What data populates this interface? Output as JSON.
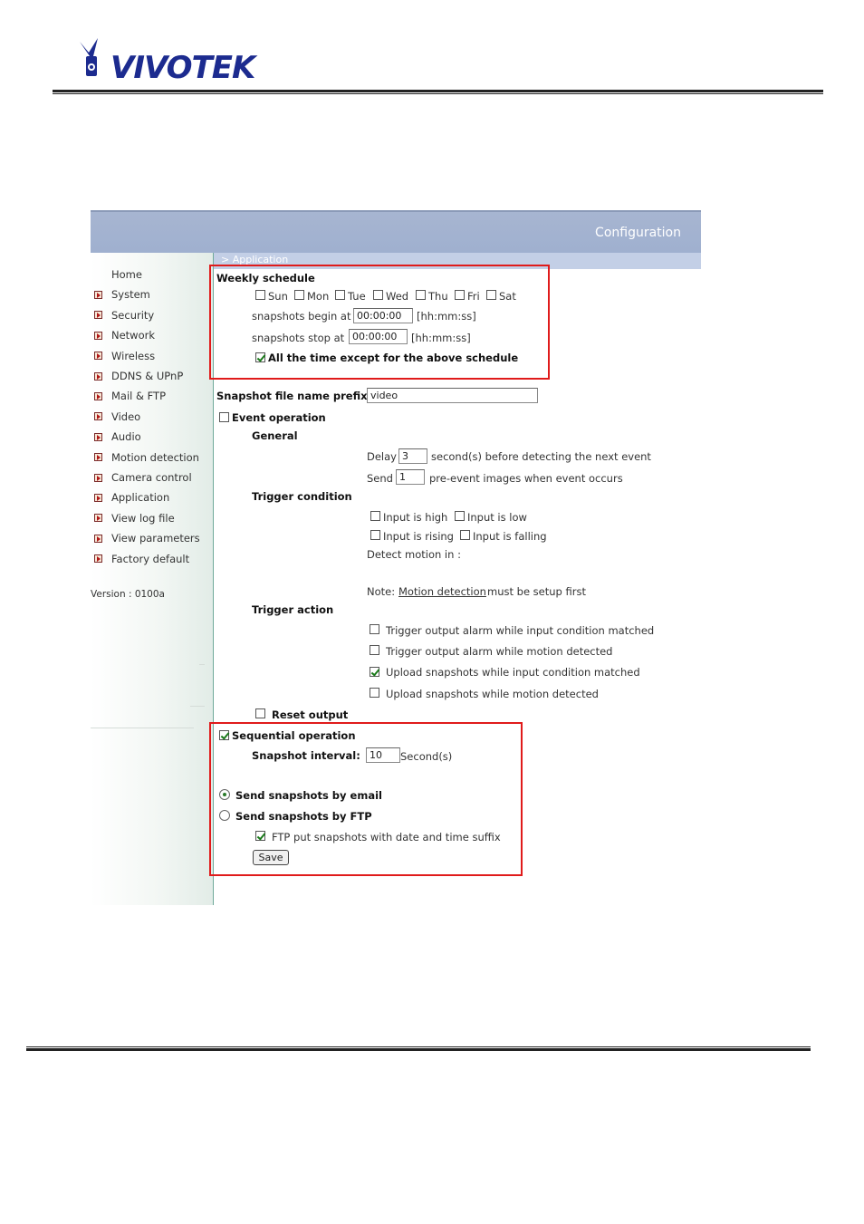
{
  "logo": {
    "text": "VIVOTEK",
    "icon": "vivotek-bird-icon"
  },
  "header": {
    "title": "Configuration",
    "breadcrumb": "> Application"
  },
  "sidebar": {
    "items": [
      {
        "label": "Home",
        "arrow": false
      },
      {
        "label": "System",
        "arrow": true
      },
      {
        "label": "Security",
        "arrow": true
      },
      {
        "label": "Network",
        "arrow": true
      },
      {
        "label": "Wireless",
        "arrow": true
      },
      {
        "label": "DDNS & UPnP",
        "arrow": true
      },
      {
        "label": "Mail & FTP",
        "arrow": true
      },
      {
        "label": "Video",
        "arrow": true
      },
      {
        "label": "Audio",
        "arrow": true
      },
      {
        "label": "Motion detection",
        "arrow": true
      },
      {
        "label": "Camera control",
        "arrow": true
      },
      {
        "label": "Application",
        "arrow": true
      },
      {
        "label": "View log file",
        "arrow": true
      },
      {
        "label": "View parameters",
        "arrow": true
      },
      {
        "label": "Factory default",
        "arrow": true
      }
    ],
    "version": "Version : 0100a"
  },
  "schedule": {
    "title": "Weekly schedule",
    "days": [
      {
        "label": "Sun",
        "checked": false
      },
      {
        "label": "Mon",
        "checked": false
      },
      {
        "label": "Tue",
        "checked": false
      },
      {
        "label": "Wed",
        "checked": false
      },
      {
        "label": "Thu",
        "checked": false
      },
      {
        "label": "Fri",
        "checked": false
      },
      {
        "label": "Sat",
        "checked": false
      }
    ],
    "begin_label": "snapshots begin at",
    "begin_value": "00:00:00",
    "begin_format": "[hh:mm:ss]",
    "stop_label": "snapshots stop at",
    "stop_value": "00:00:00",
    "stop_format": "[hh:mm:ss]",
    "all_time_label": "All the time except for the above schedule",
    "all_time_checked": true
  },
  "prefix": {
    "label": "Snapshot file name prefix",
    "value": "video"
  },
  "event": {
    "label": "Event operation",
    "checked": false,
    "general_label": "General",
    "delay_label": "Delay",
    "delay_value": "3",
    "delay_suffix": "second(s) before detecting the next event",
    "send_label": "Send",
    "send_value": "1",
    "send_suffix": "pre-event images when event occurs",
    "trigger_condition_label": "Trigger condition",
    "conditions": [
      {
        "label": "Input is high",
        "checked": false
      },
      {
        "label": "Input is low",
        "checked": false
      },
      {
        "label": "Input is rising",
        "checked": false
      },
      {
        "label": "Input is falling",
        "checked": false
      }
    ],
    "detect_motion_label": "Detect motion in :",
    "note_prefix": "Note:",
    "note_link": "Motion detection",
    "note_suffix": "must be setup first",
    "trigger_action_label": "Trigger action",
    "actions": [
      {
        "label": "Trigger output alarm while input condition matched",
        "checked": false
      },
      {
        "label": "Trigger output alarm while motion detected",
        "checked": false
      },
      {
        "label": "Upload snapshots while input condition matched",
        "checked": true
      },
      {
        "label": "Upload snapshots while motion detected",
        "checked": false
      }
    ],
    "reset_output_label": "Reset output",
    "reset_output_checked": false
  },
  "sequential": {
    "label": "Sequential operation",
    "checked": true,
    "interval_label": "Snapshot interval:",
    "interval_value": "10",
    "interval_unit": "Second(s)",
    "email_label": "Send snapshots by email",
    "email_selected": true,
    "ftp_label": "Send snapshots by FTP",
    "ftp_selected": false,
    "ftp_suffix_label": "FTP put snapshots with date and time suffix",
    "ftp_suffix_checked": true
  },
  "save_label": "Save",
  "colors": {
    "highlight_box": "#e01b1b",
    "header_bar": "#a7b5d1",
    "sidebar_border": "#6fa99a"
  }
}
